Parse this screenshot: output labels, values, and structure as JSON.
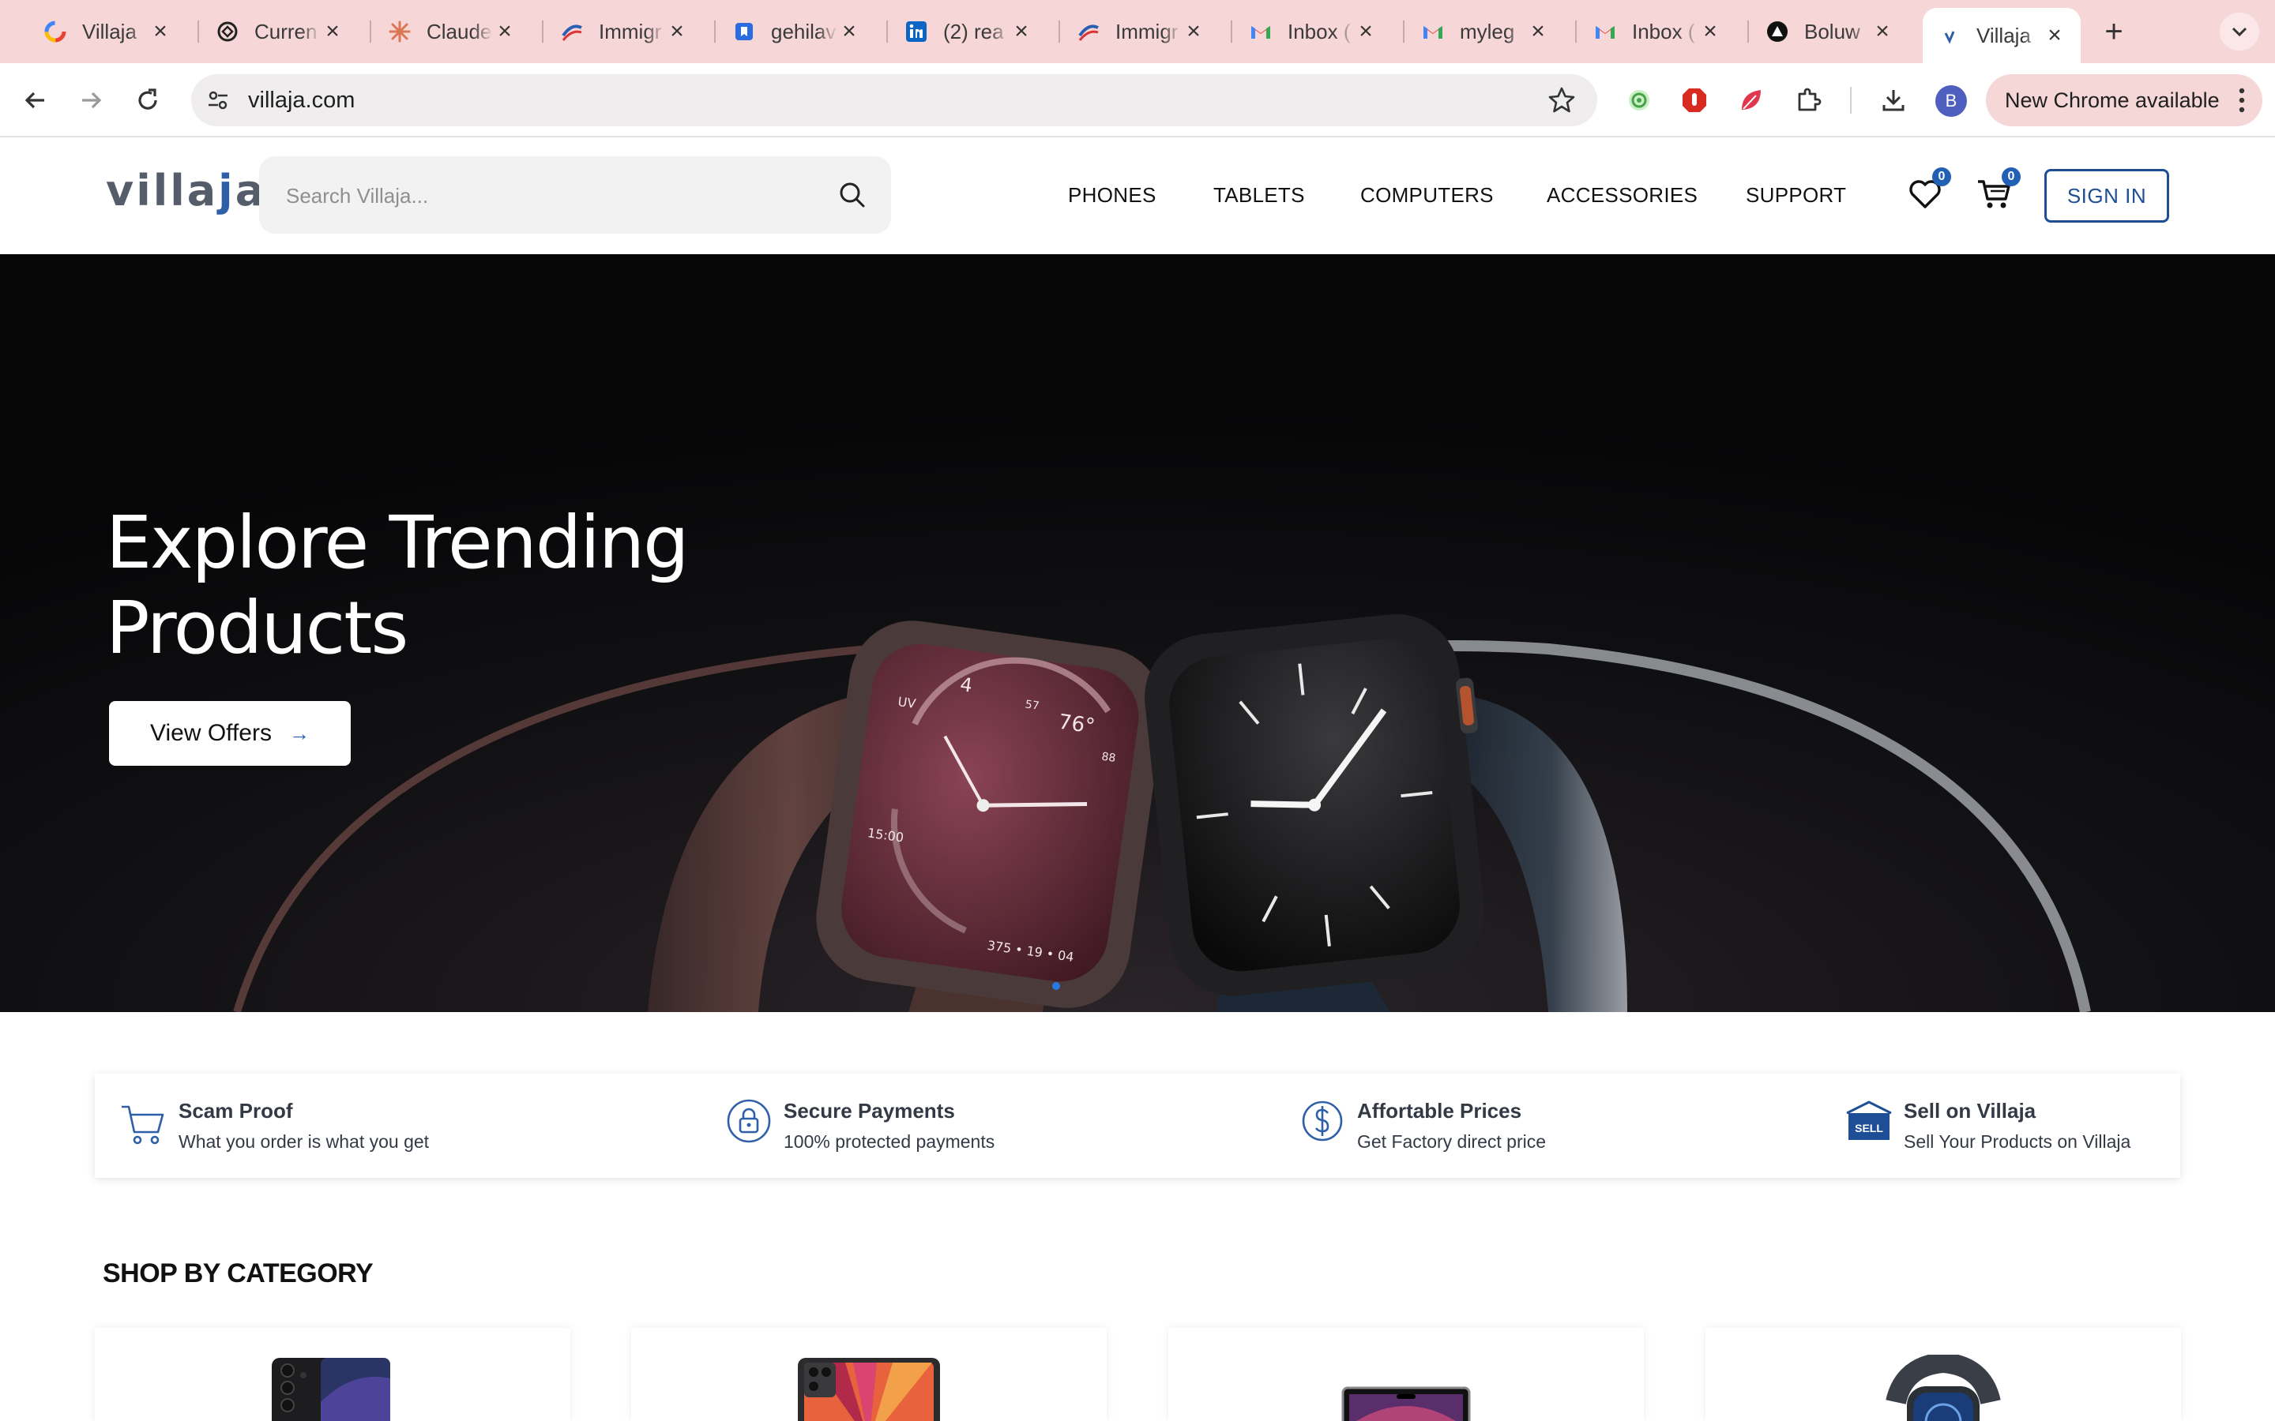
{
  "browser": {
    "tabs": [
      {
        "label": "Villaja",
        "favicon": "villaja-favicon-icon"
      },
      {
        "label": "Curren",
        "favicon": "chatgpt-icon"
      },
      {
        "label": "Claude",
        "favicon": "claude-icon"
      },
      {
        "label": "Immigr",
        "favicon": "immigration-icon"
      },
      {
        "label": "gehilav",
        "favicon": "bookmark-icon"
      },
      {
        "label": "(2) rea",
        "favicon": "linkedin-icon"
      },
      {
        "label": "Immigr",
        "favicon": "immigration-icon"
      },
      {
        "label": "Inbox (",
        "favicon": "gmail-icon"
      },
      {
        "label": "myleg",
        "favicon": "gmail-icon"
      },
      {
        "label": "Inbox (",
        "favicon": "gmail-icon"
      },
      {
        "label": "Boluw",
        "favicon": "triangle-logo-icon"
      },
      {
        "label": "Villaja",
        "favicon": "villaja-favicon-icon",
        "active": true
      }
    ],
    "url": "villaja.com",
    "profile_initial": "B",
    "update_label": "New Chrome available"
  },
  "site": {
    "logo_prefix": "villa",
    "logo_j": "j",
    "logo_suffix": "a",
    "search_placeholder": "Search Villaja...",
    "nav": [
      "PHONES",
      "TABLETS",
      "COMPUTERS",
      "ACCESSORIES",
      "SUPPORT"
    ],
    "wishlist_count": "0",
    "cart_count": "0",
    "signin_label": "SIGN IN",
    "brand_color": "#1e4f96"
  },
  "hero": {
    "title_line1": "Explore Trending",
    "title_line2": "Products",
    "cta_label": "View Offers",
    "cta_arrow": "→",
    "watch_left": {
      "n": "4",
      "uv": "UV",
      "temp": "76°",
      "a": "57",
      "b": "88",
      "c": "15:00",
      "d": "375 • 19 • 04"
    }
  },
  "features": [
    {
      "title": "Scam Proof",
      "subtitle": "What you order is what you get",
      "icon": "cart-icon"
    },
    {
      "title": "Secure Payments",
      "subtitle": "100% protected payments",
      "icon": "lock-icon"
    },
    {
      "title": "Affortable Prices",
      "subtitle": "Get Factory direct price",
      "icon": "dollar-icon"
    },
    {
      "title": "Sell on Villaja",
      "subtitle": "Sell Your Products on Villaja",
      "icon": "sell-sign-icon",
      "sign_text": "SELL"
    }
  ],
  "category": {
    "title": "SHOP BY CATEGORY",
    "cards": [
      "phones",
      "tablets",
      "computers",
      "accessories"
    ]
  }
}
